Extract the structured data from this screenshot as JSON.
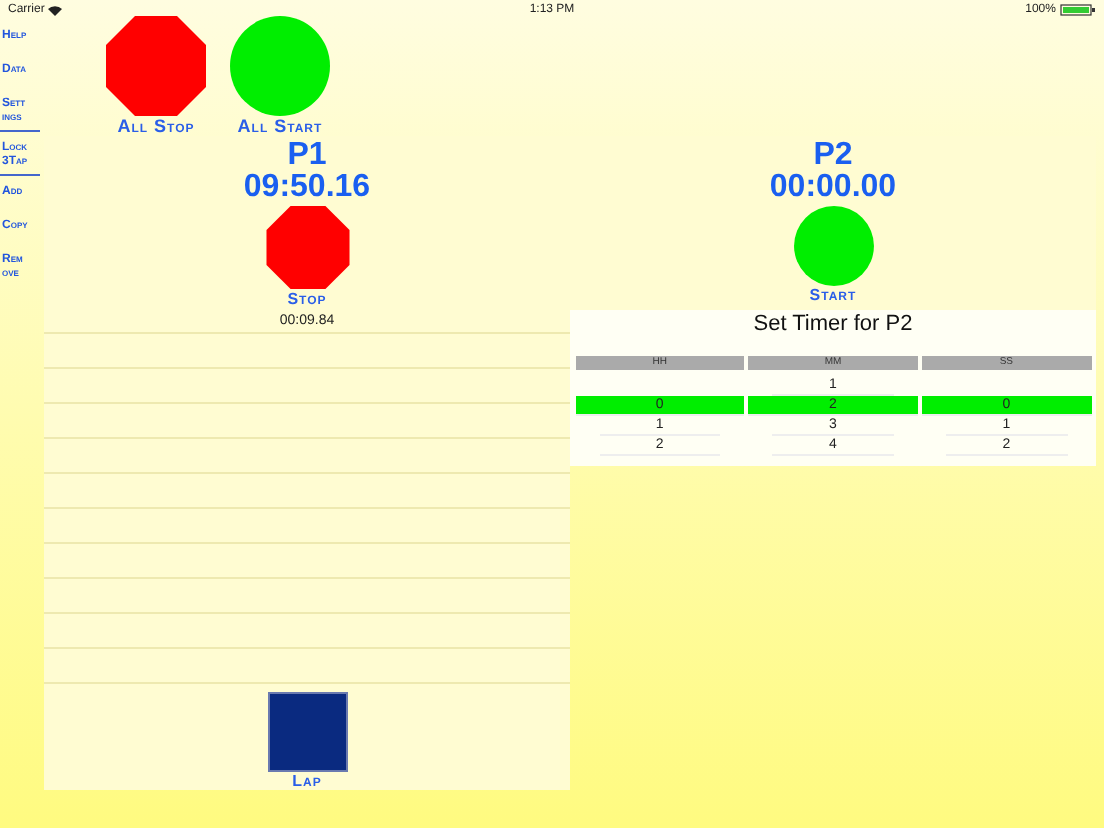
{
  "status_bar": {
    "carrier": "Carrier",
    "time": "1:13 PM",
    "battery": "100%"
  },
  "sidebar": {
    "items": [
      {
        "label": "Help",
        "divider_below": false
      },
      {
        "label": "Data",
        "divider_below": false
      },
      {
        "label": "Sett ings",
        "divider_below": true
      },
      {
        "label": "Lock 3Tap",
        "divider_below": true
      },
      {
        "label": "Add",
        "divider_below": false
      },
      {
        "label": "Copy",
        "divider_below": false
      },
      {
        "label": "Rem ove",
        "divider_below": false
      }
    ]
  },
  "global_buttons": [
    {
      "kind": "stop",
      "label": "All Stop"
    },
    {
      "kind": "start",
      "label": "All Start"
    }
  ],
  "panels": [
    {
      "title": "P1",
      "time": "09:50.16",
      "action": {
        "kind": "stop",
        "label": "Stop"
      },
      "laps": [
        "00:09.84"
      ],
      "lap_button": {
        "label": "Lap"
      }
    },
    {
      "title": "P2",
      "time": "00:00.00",
      "action": {
        "kind": "start",
        "label": "Start"
      },
      "timer_setter": {
        "title": "Set Timer for P2",
        "columns": [
          {
            "header": "HH",
            "rows": [
              {
                "label": "0",
                "selected": true
              },
              {
                "label": "1",
                "selected": false
              },
              {
                "label": "2",
                "selected": false
              }
            ]
          },
          {
            "header": "MM",
            "rows": [
              {
                "label": "1",
                "selected": false
              },
              {
                "label": "2",
                "selected": true
              },
              {
                "label": "3",
                "selected": false
              },
              {
                "label": "4",
                "selected": false
              }
            ]
          },
          {
            "header": "SS",
            "rows": [
              {
                "label": "0",
                "selected": true
              },
              {
                "label": "1",
                "selected": false
              },
              {
                "label": "2",
                "selected": false
              }
            ]
          }
        ]
      }
    }
  ]
}
